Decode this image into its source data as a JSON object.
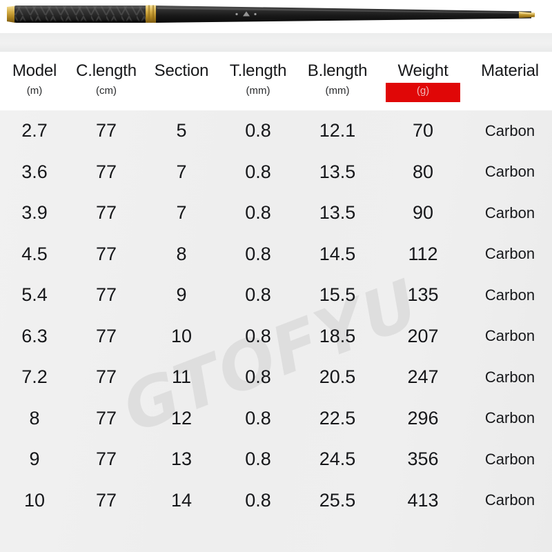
{
  "product_image": {
    "name": "carbon-fishing-rod",
    "description": "Black carbon fiber telescopic fishing rod with textured grip and gold ferrules",
    "colors": {
      "rod_body": "#1b1b1b",
      "grip": "#2b2b2b",
      "ferrule_gold": "#c9a23a",
      "background": "#ffffff",
      "shelf": "#eceded"
    }
  },
  "watermark": {
    "text": "GTOFYU",
    "color": "#dedede",
    "rotation_deg": -21
  },
  "table": {
    "columns": [
      {
        "name": "Model",
        "unit": "(m)",
        "highlight": false
      },
      {
        "name": "C.length",
        "unit": "(cm)",
        "highlight": false
      },
      {
        "name": "Section",
        "unit": "",
        "highlight": false
      },
      {
        "name": "T.length",
        "unit": "(mm)",
        "highlight": false
      },
      {
        "name": "B.length",
        "unit": "(mm)",
        "highlight": false
      },
      {
        "name": "Weight",
        "unit": "(g)",
        "highlight": true
      },
      {
        "name": "Material",
        "unit": "",
        "highlight": false
      }
    ],
    "highlight_color": "#e00707",
    "rows": [
      {
        "model": "2.7",
        "clength": "77",
        "section": "5",
        "tlength": "0.8",
        "blength": "12.1",
        "weight": "70",
        "material": "Carbon"
      },
      {
        "model": "3.6",
        "clength": "77",
        "section": "7",
        "tlength": "0.8",
        "blength": "13.5",
        "weight": "80",
        "material": "Carbon"
      },
      {
        "model": "3.9",
        "clength": "77",
        "section": "7",
        "tlength": "0.8",
        "blength": "13.5",
        "weight": "90",
        "material": "Carbon"
      },
      {
        "model": "4.5",
        "clength": "77",
        "section": "8",
        "tlength": "0.8",
        "blength": "14.5",
        "weight": "112",
        "material": "Carbon"
      },
      {
        "model": "5.4",
        "clength": "77",
        "section": "9",
        "tlength": "0.8",
        "blength": "15.5",
        "weight": "135",
        "material": "Carbon"
      },
      {
        "model": "6.3",
        "clength": "77",
        "section": "10",
        "tlength": "0.8",
        "blength": "18.5",
        "weight": "207",
        "material": "Carbon"
      },
      {
        "model": "7.2",
        "clength": "77",
        "section": "11",
        "tlength": "0.8",
        "blength": "20.5",
        "weight": "247",
        "material": "Carbon"
      },
      {
        "model": "8",
        "clength": "77",
        "section": "12",
        "tlength": "0.8",
        "blength": "22.5",
        "weight": "296",
        "material": "Carbon"
      },
      {
        "model": "9",
        "clength": "77",
        "section": "13",
        "tlength": "0.8",
        "blength": "24.5",
        "weight": "356",
        "material": "Carbon"
      },
      {
        "model": "10",
        "clength": "77",
        "section": "14",
        "tlength": "0.8",
        "blength": "25.5",
        "weight": "413",
        "material": "Carbon"
      }
    ]
  }
}
